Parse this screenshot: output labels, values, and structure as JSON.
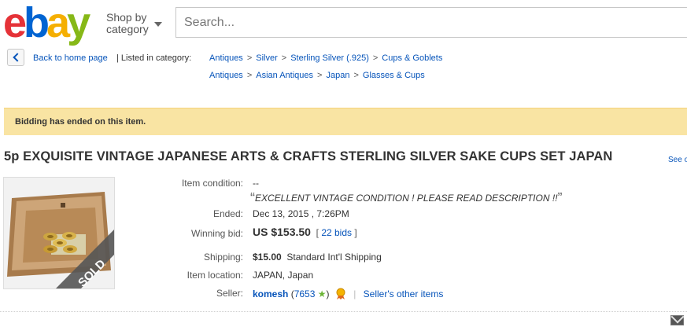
{
  "header": {
    "logo": {
      "e": "e",
      "b": "b",
      "a": "a",
      "y": "y"
    },
    "shop_by_line1": "Shop by",
    "shop_by_line2": "category",
    "search_placeholder": "Search..."
  },
  "breadcrumb": {
    "back_label": "Back to home page",
    "listed_in": "| Listed in category:",
    "row1": [
      "Antiques",
      "Silver",
      "Sterling Silver (.925)",
      "Cups & Goblets"
    ],
    "row2": [
      "Antiques",
      "Asian Antiques",
      "Japan",
      "Glasses & Cups"
    ],
    "separator": ">"
  },
  "alert": {
    "message": "Bidding has ended on this item."
  },
  "item": {
    "title": "5p EXQUISITE VINTAGE JAPANESE ARTS & CRAFTS STERLING SILVER SAKE CUPS SET JAPAN",
    "see_more": "See o",
    "sold_badge": "SOLD",
    "condition_label": "Item condition:",
    "condition_value": "--",
    "condition_note": "EXCELLENT VINTAGE CONDITION ! PLEASE READ DESCRIPTION !!",
    "ended_label": "Ended:",
    "ended_value": "Dec 13, 2015 , 7:26PM",
    "winning_bid_label": "Winning bid:",
    "winning_bid_value": "US $153.50",
    "bids_open": "[",
    "bids_link": "22 bids",
    "bids_close": "]",
    "shipping_label": "Shipping:",
    "shipping_cost": "$15.00",
    "shipping_method": "Standard Int'l Shipping",
    "location_label": "Item location:",
    "location_value": "JAPAN, Japan",
    "seller_label": "Seller:",
    "seller_name": "komesh",
    "seller_feedback": "7653",
    "seller_other_items": "Seller's other items"
  },
  "colors": {
    "link": "#0654ba",
    "alert_bg": "#f9e4a3",
    "logo_e": "#e53238",
    "logo_b": "#0064d2",
    "logo_a": "#f5af02",
    "logo_y": "#86b817",
    "feedback_star": "#6ab435",
    "visited_link": "#6c3d8f"
  },
  "icons": [
    "back-chevron-icon",
    "chevron-down-icon",
    "star-icon",
    "top-rated-seller-icon",
    "mail-icon"
  ]
}
